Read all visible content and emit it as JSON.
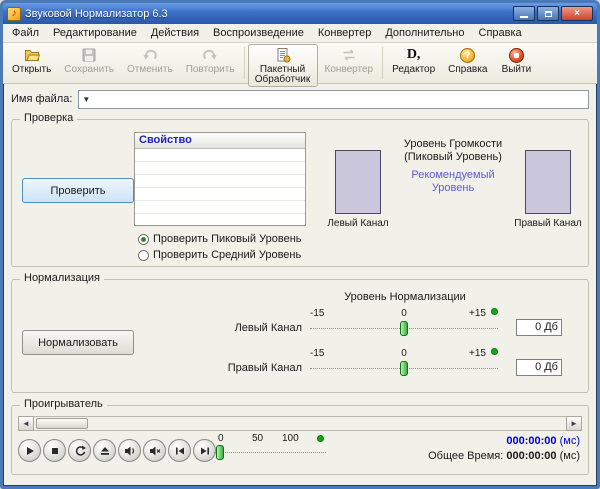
{
  "window": {
    "title": "Звуковой Нормализатор 6.3"
  },
  "menu": {
    "items": [
      "Файл",
      "Редактирование",
      "Действия",
      "Воспроизведение",
      "Конвертер",
      "Дополнительно",
      "Справка"
    ]
  },
  "toolbar": {
    "buttons": [
      {
        "label": "Открыть",
        "icon": "open-folder-icon",
        "enabled": true
      },
      {
        "label": "Сохранить",
        "icon": "save-icon",
        "enabled": false
      },
      {
        "label": "Отменить",
        "icon": "undo-icon",
        "enabled": false
      },
      {
        "label": "Повторить",
        "icon": "redo-icon",
        "enabled": false
      },
      {
        "label": "Пакетный Обработчик",
        "icon": "batch-processor-icon",
        "enabled": true
      },
      {
        "label": "Конвертер",
        "icon": "converter-icon",
        "enabled": false
      },
      {
        "label": "Редактор",
        "icon": "editor-icon",
        "enabled": true
      },
      {
        "label": "Справка",
        "icon": "help-icon",
        "enabled": true
      },
      {
        "label": "Выйти",
        "icon": "exit-icon",
        "enabled": true
      }
    ]
  },
  "file_row": {
    "label": "Имя файла:",
    "value": ""
  },
  "check": {
    "group_title": "Проверка",
    "check_button": "Проверить",
    "table_header": "Свойство",
    "empty_rows": 6,
    "radio_peak": "Проверить Пиковый Уровень",
    "radio_average": "Проверить Средний Уровень",
    "radio_selected": "peak",
    "volume_title_line1": "Уровень Громкости",
    "volume_title_line2": "(Пиковый Уровень)",
    "recommended_line1": "Рекомендуемый",
    "recommended_line2": "Уровень",
    "left_channel_label": "Левый Канал",
    "right_channel_label": "Правый Канал"
  },
  "normalize": {
    "group_title": "Нормализация",
    "normalize_button": "Нормализовать",
    "level_title": "Уровень Нормализации",
    "scale_min": "-15",
    "scale_mid": "0",
    "scale_max": "+15",
    "left_channel_label": "Левый Канал",
    "right_channel_label": "Правый Канал",
    "left_value": "0 Дб",
    "right_value": "0 Дб",
    "left_slider_position": 0,
    "right_slider_position": 0
  },
  "player": {
    "group_title": "Проигрыватель",
    "button_icons": [
      "play-icon",
      "stop-icon",
      "repeat-icon",
      "eject-icon",
      "volume-icon",
      "mute-icon",
      "previous-track-icon",
      "next-track-icon"
    ],
    "scale": [
      "0",
      "50",
      "100"
    ],
    "current_time": "000:00:00",
    "current_time_unit": "(мс)",
    "total_time_label": "Общее Время:",
    "total_time": "000:00:00",
    "total_time_unit": "(мс)"
  },
  "colors": {
    "title_bar_blue": "#3b6fc6",
    "recommended_link": "#5b5bd8",
    "table_header_text": "#2020c0",
    "green_indicator": "#12a812",
    "current_time_blue": "#0000d4",
    "channel_meter_fill": "#cac7dd"
  }
}
